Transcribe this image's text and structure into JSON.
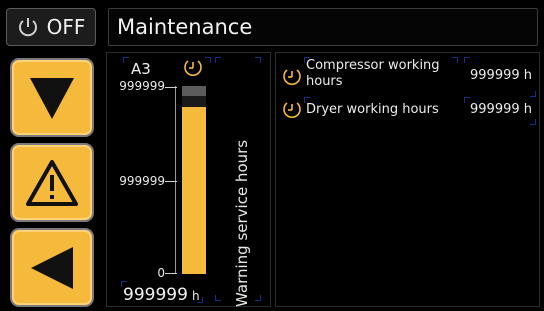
{
  "power": {
    "label": "OFF"
  },
  "header": {
    "title": "Maintenance"
  },
  "nav": {
    "down": "arrow-down-icon",
    "warning": "warning-icon",
    "back": "arrow-left-icon"
  },
  "colors": {
    "accent": "#f5b93c",
    "background": "#000000",
    "border": "#3c3c3c"
  },
  "gauge": {
    "name": "A3",
    "ticks": [
      "999999",
      "999999",
      "0"
    ],
    "fill_fraction": 0.94,
    "vertical_label": "Warning service hours",
    "value": "999999",
    "unit": "h"
  },
  "counters": [
    {
      "name": "Compressor working hours",
      "value": "999999 h"
    },
    {
      "name": "Dryer working hours",
      "value": "999999 h"
    }
  ]
}
